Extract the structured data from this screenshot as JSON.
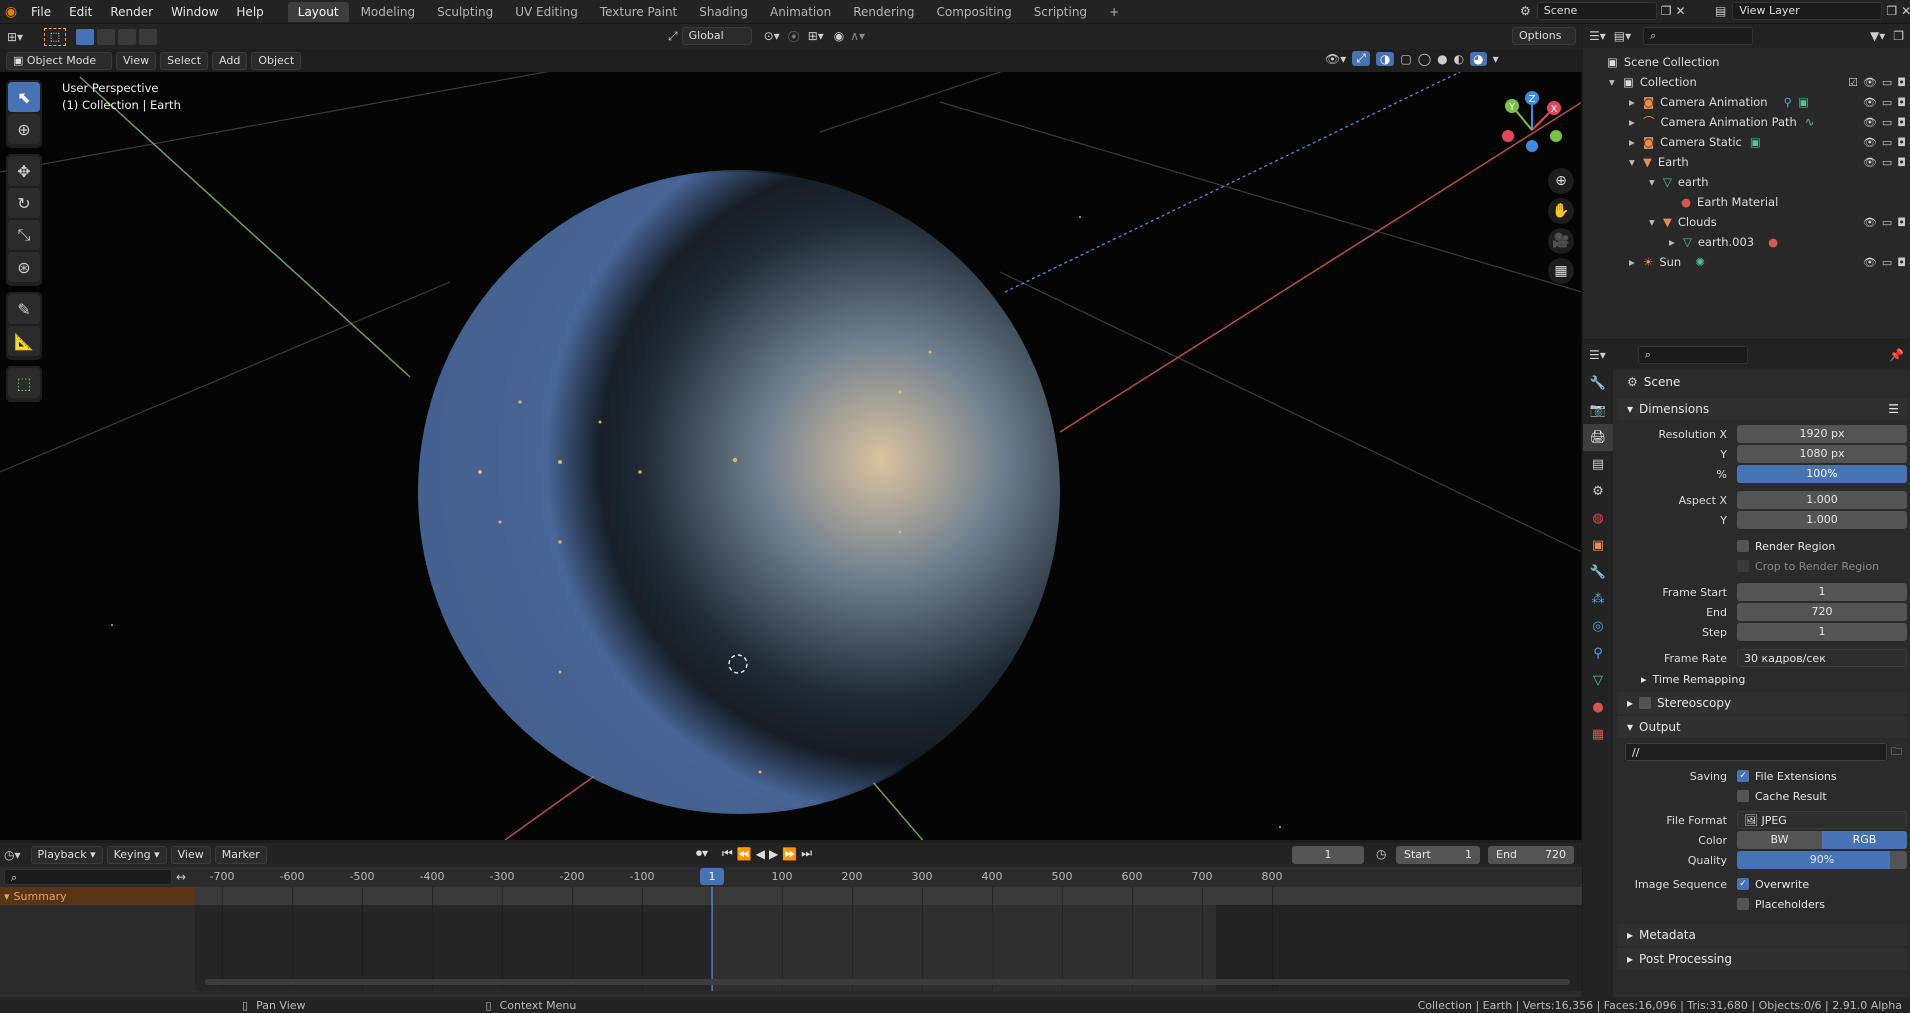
{
  "menubar": {
    "items": [
      "File",
      "Edit",
      "Render",
      "Window",
      "Help"
    ],
    "workspaces": [
      "Layout",
      "Modeling",
      "Sculpting",
      "UV Editing",
      "Texture Paint",
      "Shading",
      "Animation",
      "Rendering",
      "Compositing",
      "Scripting"
    ],
    "active_workspace": "Layout",
    "add_workspace": "+",
    "scene_name": "Scene",
    "view_layer": "View Layer"
  },
  "toolbar": {
    "transform_orientation": "Global",
    "options_label": "Options"
  },
  "viewport": {
    "mode": "Object Mode",
    "menus": [
      "View",
      "Select",
      "Add",
      "Object"
    ],
    "overlay_title": "User Perspective",
    "overlay_subtitle": "(1) Collection | Earth",
    "gizmo_axes": [
      "Z",
      "Y",
      "X"
    ]
  },
  "outliner": {
    "search_placeholder": "",
    "rows": [
      {
        "label": "Scene Collection",
        "icon": "collection-icon",
        "indent": 0
      },
      {
        "label": "Collection",
        "icon": "collection-icon",
        "indent": 1
      },
      {
        "label": "Camera Animation",
        "icon": "camera-icon",
        "indent": 2
      },
      {
        "label": "Camera Animation Path",
        "icon": "curve-icon",
        "indent": 2
      },
      {
        "label": "Camera Static",
        "icon": "camera-icon",
        "indent": 2
      },
      {
        "label": "Earth",
        "icon": "mesh-icon",
        "indent": 2
      },
      {
        "label": "earth",
        "icon": "mesh-data-icon",
        "indent": 3
      },
      {
        "label": "Earth Material",
        "icon": "material-icon",
        "indent": 4
      },
      {
        "label": "Clouds",
        "icon": "mesh-icon",
        "indent": 3
      },
      {
        "label": "earth.003",
        "icon": "mesh-data-icon",
        "indent": 4
      },
      {
        "label": "Sun",
        "icon": "light-icon",
        "indent": 2
      }
    ]
  },
  "properties": {
    "context": "Scene",
    "dimensions_title": "Dimensions",
    "resolution_x_label": "Resolution X",
    "resolution_x": "1920 px",
    "resolution_y_label": "Y",
    "resolution_y": "1080 px",
    "percent_label": "%",
    "percent": "100%",
    "aspect_x_label": "Aspect X",
    "aspect_x": "1.000",
    "aspect_y_label": "Y",
    "aspect_y": "1.000",
    "render_region": "Render Region",
    "crop_region": "Crop to Render Region",
    "frame_start_label": "Frame Start",
    "frame_start": "1",
    "frame_end_label": "End",
    "frame_end": "720",
    "frame_step_label": "Step",
    "frame_step": "1",
    "frame_rate_label": "Frame Rate",
    "frame_rate": "30 кадров/сек",
    "time_remapping": "Time Remapping",
    "stereoscopy": "Stereoscopy",
    "output_title": "Output",
    "output_path": "//",
    "saving_label": "Saving",
    "file_extensions": "File Extensions",
    "cache_result": "Cache Result",
    "file_format_label": "File Format",
    "file_format": "JPEG",
    "color_label": "Color",
    "color_bw": "BW",
    "color_rgb": "RGB",
    "quality_label": "Quality",
    "quality": "90%",
    "quality_fraction": 0.9,
    "image_sequence_label": "Image Sequence",
    "overwrite": "Overwrite",
    "placeholders": "Placeholders",
    "metadata": "Metadata",
    "post_processing": "Post Processing"
  },
  "timeline": {
    "menus": [
      "Playback",
      "Keying",
      "View",
      "Marker"
    ],
    "current_frame": "1",
    "start_label": "Start",
    "start": "1",
    "end_label": "End",
    "end": "720",
    "ticks": [
      "-700",
      "-600",
      "-500",
      "-400",
      "-300",
      "-200",
      "-100",
      "1",
      "100",
      "200",
      "300",
      "400",
      "500",
      "600",
      "700",
      "800"
    ],
    "summary": "Summary"
  },
  "statusbar": {
    "pan_view": "Pan View",
    "context_menu": "Context Menu",
    "stats": "Collection | Earth | Verts:16,356 | Faces:16,096 | Tris:31,680 | Objects:0/6 | 2.91.0 Alpha"
  },
  "colors": {
    "accent": "#4772b3",
    "x_axis": "#e2485a",
    "y_axis": "#7bc043",
    "z_axis": "#3f8ae3"
  }
}
